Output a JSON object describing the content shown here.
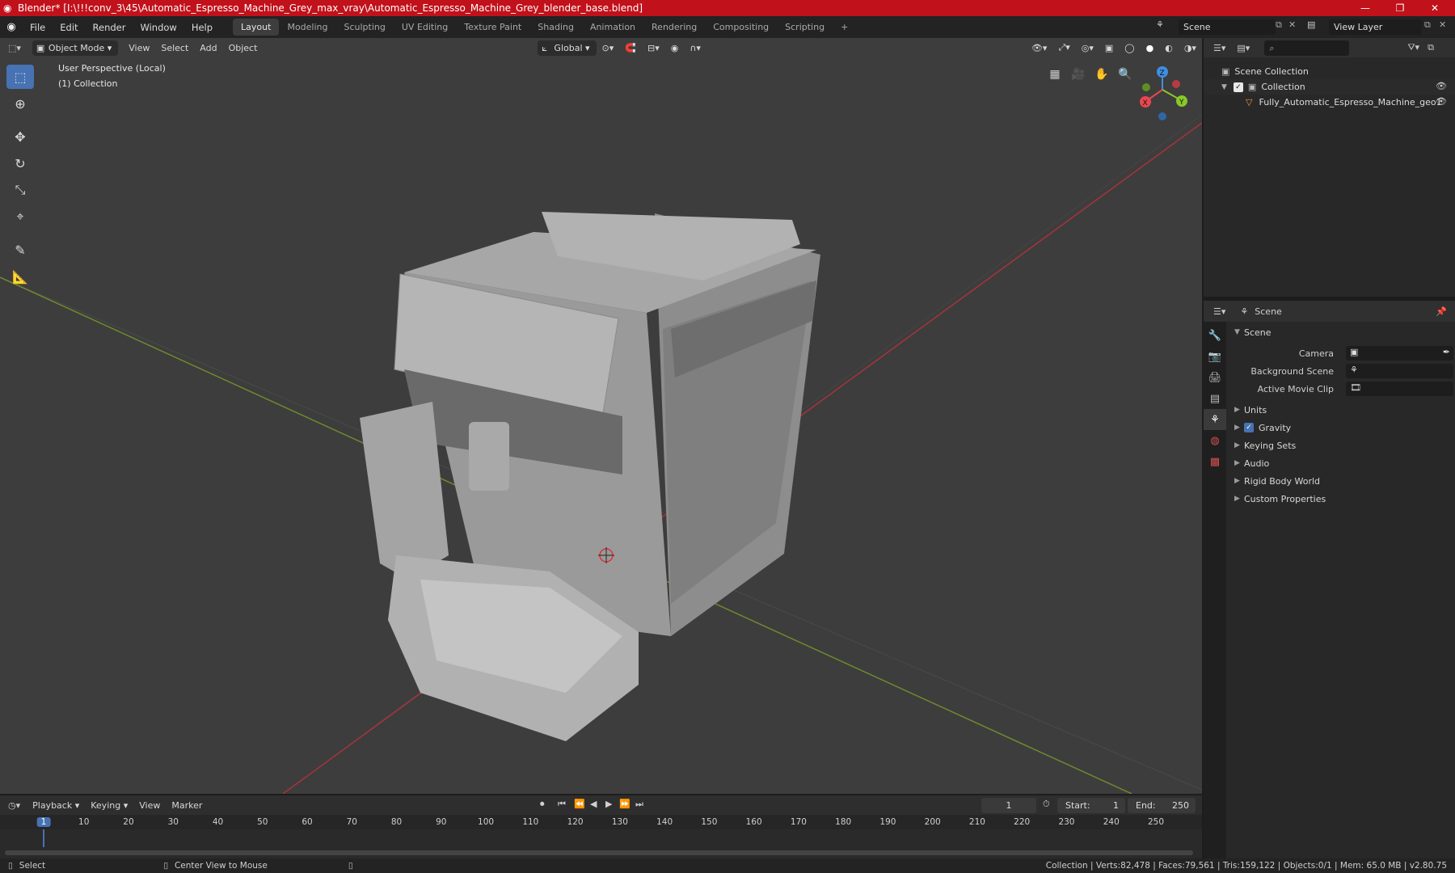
{
  "window": {
    "title": "Blender* [I:\\!!!conv_3\\45\\Automatic_Espresso_Machine_Grey_max_vray\\Automatic_Espresso_Machine_Grey_blender_base.blend]",
    "minimize": "—",
    "maximize": "❐",
    "close": "✕"
  },
  "menu": {
    "items": [
      "File",
      "Edit",
      "Render",
      "Window",
      "Help"
    ]
  },
  "workspaces": {
    "tabs": [
      "Layout",
      "Modeling",
      "Sculpting",
      "UV Editing",
      "Texture Paint",
      "Shading",
      "Animation",
      "Rendering",
      "Compositing",
      "Scripting"
    ],
    "add": "+",
    "active": "Layout"
  },
  "scene_selector": {
    "value": "Scene"
  },
  "viewlayer_selector": {
    "value": "View Layer"
  },
  "viewport_header": {
    "mode": "Object Mode",
    "menus": [
      "View",
      "Select",
      "Add",
      "Object"
    ],
    "orientation": "Global"
  },
  "viewport": {
    "perspective": "User Perspective (Local)",
    "collection": "(1) Collection",
    "gizmo": {
      "x": "X",
      "y": "Y",
      "z": "Z"
    }
  },
  "outliner": {
    "search_placeholder": "",
    "rows": [
      {
        "label": "Scene Collection",
        "icon": "collection-icon"
      },
      {
        "label": "Collection",
        "icon": "collection-icon"
      },
      {
        "label": "Fully_Automatic_Espresso_Machine_geo1",
        "icon": "mesh-icon"
      }
    ]
  },
  "properties": {
    "header": "Scene",
    "panel": "Scene",
    "fields": [
      {
        "label": "Camera"
      },
      {
        "label": "Background Scene"
      },
      {
        "label": "Active Movie Clip"
      }
    ],
    "groups": [
      "Units",
      "Gravity",
      "Keying Sets",
      "Audio",
      "Rigid Body World",
      "Custom Properties"
    ]
  },
  "timeline": {
    "menus": [
      "Playback",
      "Keying",
      "View",
      "Marker"
    ],
    "current_frame": "1",
    "start_label": "Start:",
    "start": "1",
    "end_label": "End:",
    "end": "250",
    "ticks": [
      "1",
      "10",
      "20",
      "30",
      "40",
      "50",
      "60",
      "70",
      "80",
      "90",
      "100",
      "110",
      "120",
      "130",
      "140",
      "150",
      "160",
      "170",
      "180",
      "190",
      "200",
      "210",
      "220",
      "230",
      "240",
      "250"
    ]
  },
  "statusbar": {
    "select": "Select",
    "center": "Center View to Mouse",
    "stats": "Collection | Verts:82,478 | Faces:79,561 | Tris:159,122 | Objects:0/1 | Mem: 65.0 MB | v2.80.75"
  },
  "colors": {
    "accent": "#4772b3",
    "titlebar": "#c1111a",
    "viewport_bg": "#3d3d3d",
    "axis_x": "#e8474f",
    "axis_y": "#8ac728",
    "axis_z": "#3f8fe0"
  }
}
